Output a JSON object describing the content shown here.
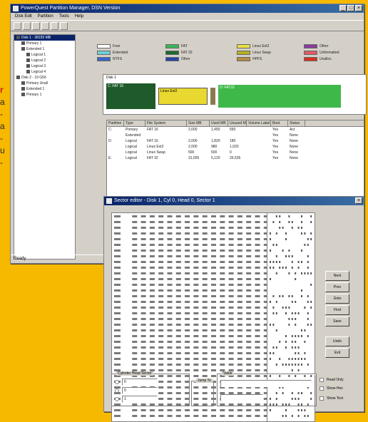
{
  "page_text": {
    "accent_fragment": "r",
    "trailing_glyphs": [
      "a",
      "-",
      "a",
      "-",
      "u",
      "-"
    ]
  },
  "main_window": {
    "title": "PowerQuest Partition Manager, DSN Version",
    "menu": [
      "Disk Edit",
      "Partition",
      "Tools",
      "Help"
    ],
    "tree_items": [
      {
        "label": "Disk 1 - 38155 MB",
        "level": 0,
        "selected": true
      },
      {
        "label": "Primary 1",
        "level": 1
      },
      {
        "label": "Extended 1",
        "level": 1
      },
      {
        "label": "Logical 1",
        "level": 2
      },
      {
        "label": "Logical 2",
        "level": 2
      },
      {
        "label": "Logical 3",
        "level": 2
      },
      {
        "label": "Logical 4",
        "level": 2
      },
      {
        "label": "Disk 2 - 19 G56",
        "level": 0
      },
      {
        "label": "Primary Unall",
        "level": 1
      },
      {
        "label": "Extended 1",
        "level": 1
      },
      {
        "label": "Primary 1",
        "level": 1
      }
    ],
    "legend": [
      {
        "label": "Free",
        "color": "#ffffff"
      },
      {
        "label": "Extended",
        "color": "#6fd0d8"
      },
      {
        "label": "FAT",
        "color": "#3bb65b"
      },
      {
        "label": "FAT 32",
        "color": "#1e6a2a"
      },
      {
        "label": "Other",
        "color": "#2844a8"
      },
      {
        "label": "NTFS",
        "color": "#3a66c8"
      },
      {
        "label": "Linux Ext2",
        "color": "#e8e040"
      },
      {
        "label": "Linux Swap",
        "color": "#b8b020"
      },
      {
        "label": "HPFS",
        "color": "#b88a40"
      },
      {
        "label": "Other",
        "color": "#8a3a9a"
      },
      {
        "label": "Unformatted",
        "color": "#e05a6a"
      },
      {
        "label": "Unalloc.",
        "color": "#d83020"
      }
    ],
    "disk_map": {
      "caption": "Disk 1",
      "segments": [
        {
          "label": "C: FAT 16",
          "color": "#1e5a2a",
          "share": 0.2
        },
        {
          "label": "Linux Ext2",
          "color": "#e8d830",
          "share": 0.2
        },
        {
          "label": "",
          "color": "#8a7a50",
          "share": 0.02
        },
        {
          "label": "D: FAT32",
          "color": "#3fb84a",
          "share": 0.5
        }
      ]
    },
    "table": {
      "headers": [
        "Partition",
        "Type",
        "File System",
        "Size MB",
        "Used MB",
        "Unused MB",
        "Volume Label",
        "Boot",
        "Status"
      ],
      "rows": [
        [
          "C:",
          "Primary",
          "FAT 16",
          "2,000",
          "1,450",
          "550",
          "Yes",
          "Act"
        ],
        [
          "",
          "Extended",
          "",
          "",
          "",
          "",
          "Yes",
          "None"
        ],
        [
          "D:",
          "Logical",
          "FAT 16",
          "2,000",
          "1,820",
          "180",
          "Yes",
          "None"
        ],
        [
          "",
          "Logical",
          "Linux Ext2",
          "2,000",
          "980",
          "1,020",
          "Yes",
          "None"
        ],
        [
          "",
          "Logical",
          "Linux Swap",
          "500",
          "500",
          "0",
          "Yes",
          "None"
        ],
        [
          "E:",
          "Logical",
          "FAT 32",
          "31,655",
          "5,120",
          "26,535",
          "Yes",
          "None"
        ]
      ]
    },
    "status": "Ready"
  },
  "hex_window": {
    "title": "Sector editor - Disk 1, Cyl 0, Head 0, Sector 1",
    "buttons": [
      "Next",
      "Prev",
      "Goto",
      "Find",
      "Save",
      "Undo",
      "Exit"
    ],
    "goto_group": "Cylinder Head Sector",
    "jump_group": "Jump To",
    "value_group": "Value",
    "check_labels": [
      "Read Only",
      "Show Hex",
      "Show Text"
    ],
    "field_values": [
      "0",
      "0",
      "1"
    ]
  }
}
